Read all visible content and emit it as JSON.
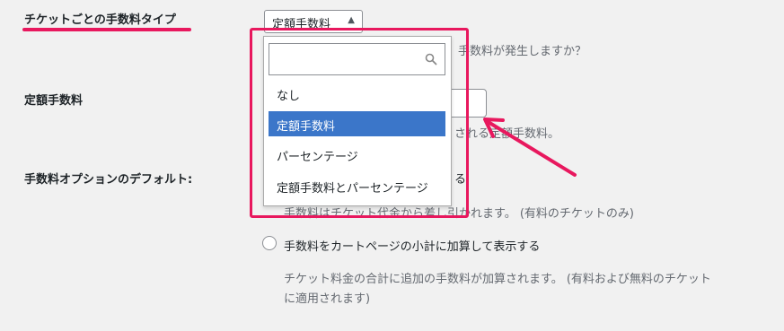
{
  "settings": {
    "fee_type_label": "チケットごとの手数料タイプ",
    "fee_type_select_value": "定額手数料",
    "fee_type_help_partial": "手数料が発生しますか？",
    "fixed_fee_label": "定額手数料",
    "fixed_fee_help_partial": "される定額手数料。",
    "fee_option_label": "手数料オプションのデフォルト:",
    "option1_label_partial": "る",
    "option1_desc_partial": "手数料はチケット代金から差し引かれます。 (有料のチケットのみ)",
    "option2_label": "手数料をカートページの小計に加算して表示する",
    "option2_desc_line1": "チケット料金の合計に追加の手数料が加算されます。 (有料および無料のチケット",
    "option2_desc_line2": "に適用されます)"
  },
  "dropdown": {
    "search_placeholder": "",
    "options": [
      {
        "label": "なし",
        "selected": false
      },
      {
        "label": "定額手数料",
        "selected": true
      },
      {
        "label": "パーセンテージ",
        "selected": false
      },
      {
        "label": "定額手数料とパーセンテージ",
        "selected": false
      }
    ]
  },
  "colors": {
    "annotation": "#e8185e",
    "selected_option": "#3b76c9"
  },
  "icons": {
    "search": "search-icon",
    "caret": "caret-up-icon"
  }
}
